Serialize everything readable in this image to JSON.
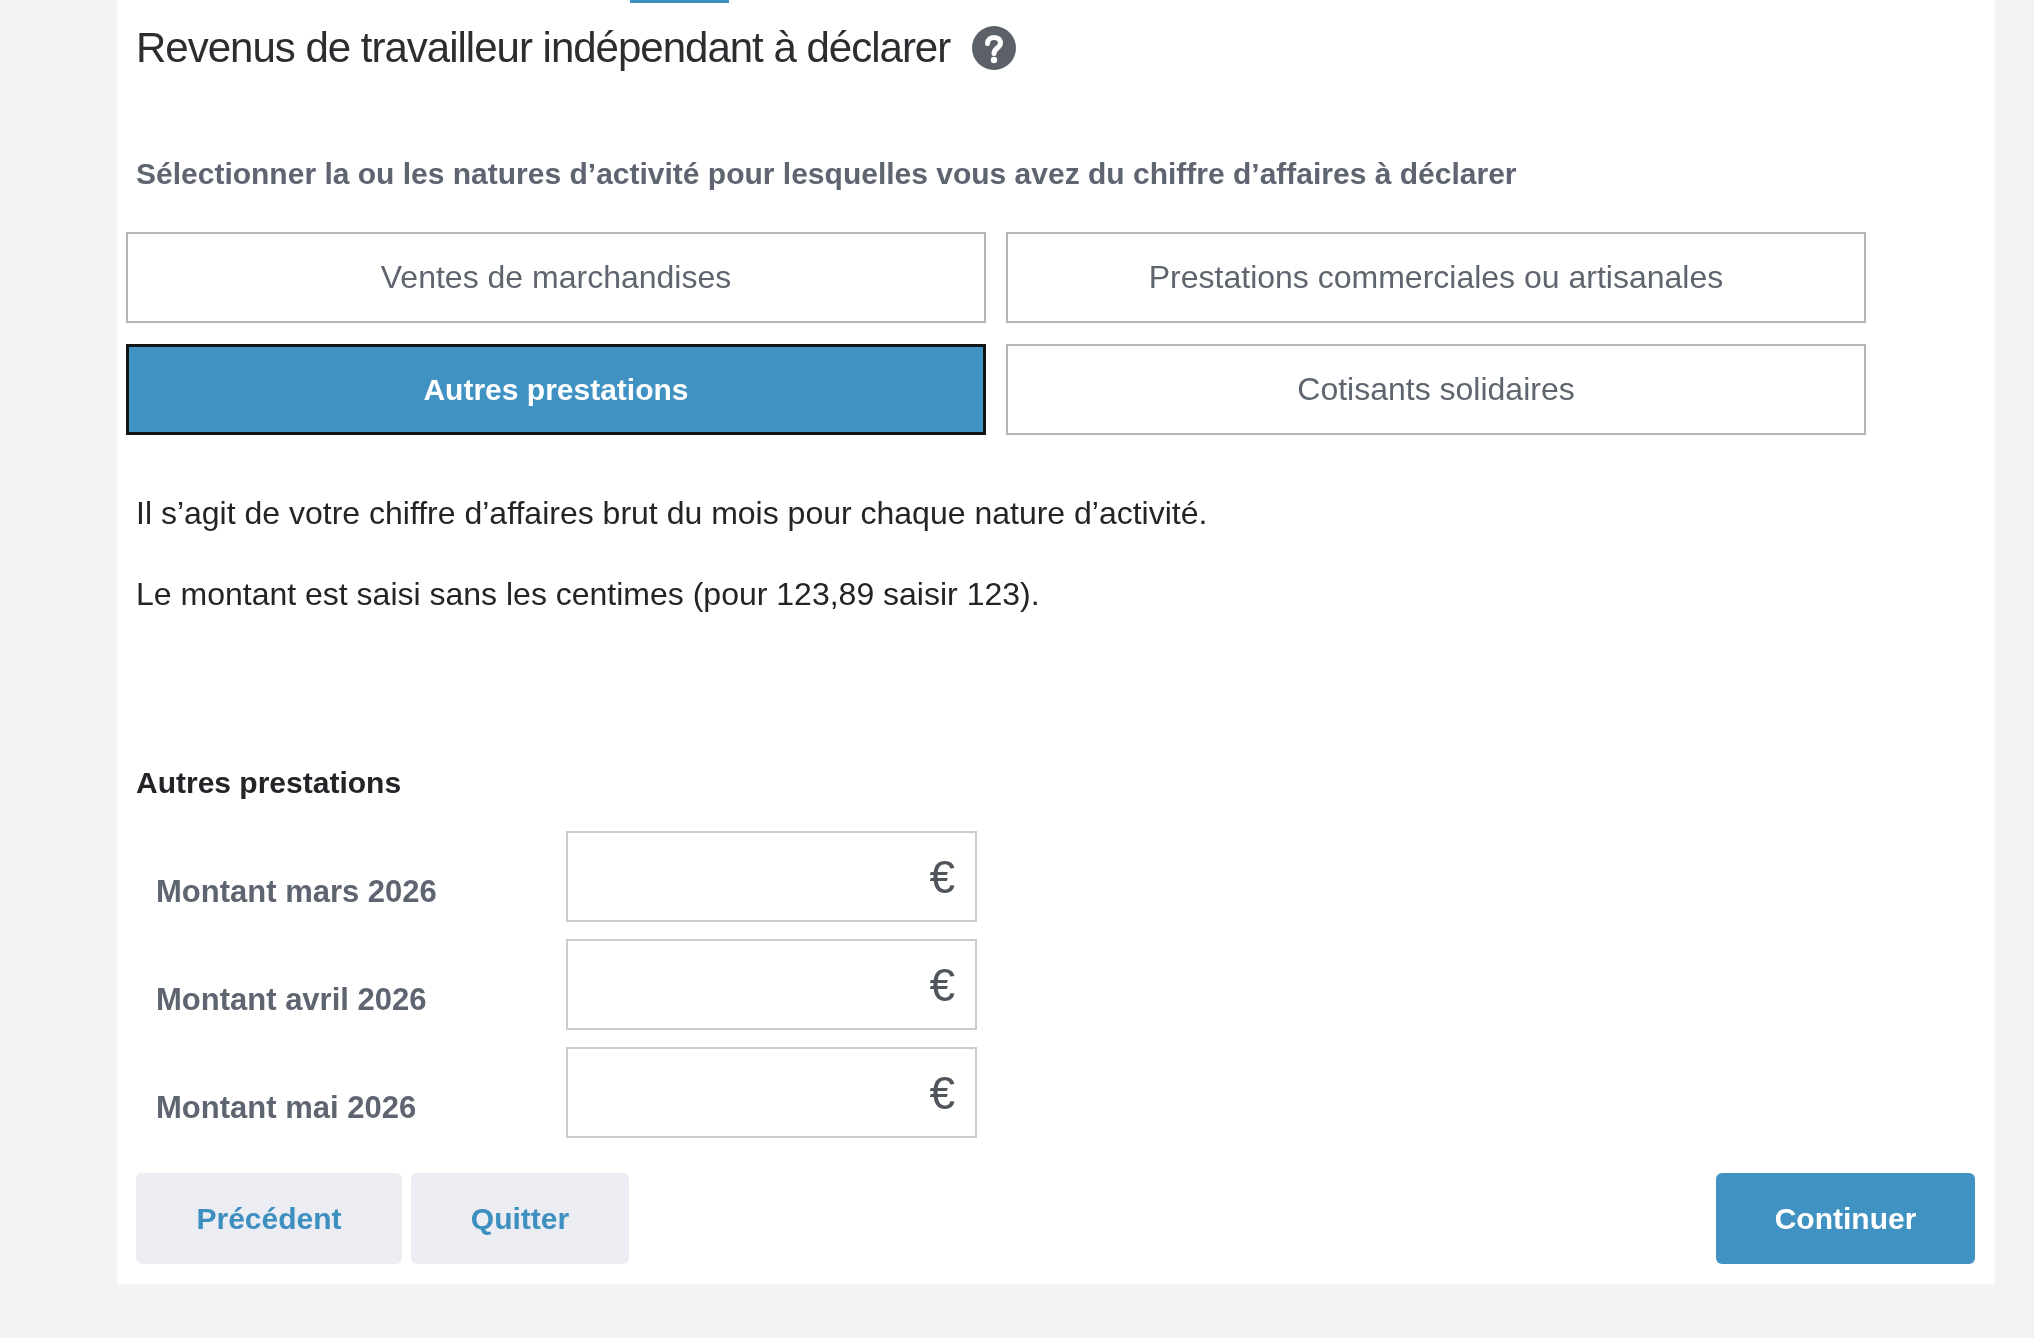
{
  "title": "Revenus de travailleur indépendant à déclarer",
  "intro": "Sélectionner la ou les natures d’activité pour lesquelles vous avez du chiffre d’affaires à déclarer",
  "activity_options": [
    {
      "label": "Ventes de marchandises",
      "selected": false
    },
    {
      "label": "Prestations commerciales ou artisanales",
      "selected": false
    },
    {
      "label": "Autres prestations",
      "selected": true
    },
    {
      "label": "Cotisants solidaires",
      "selected": false
    }
  ],
  "notes": [
    "Il s’agit de votre chiffre d’affaires brut du mois pour chaque nature d’activité.",
    "Le montant est saisi sans les centimes (pour 123,89 saisir 123)."
  ],
  "section": {
    "title": "Autres prestations",
    "fields": [
      {
        "label": "Montant mars 2026",
        "unit": "€"
      },
      {
        "label": "Montant avril 2026",
        "unit": "€"
      },
      {
        "label": "Montant mai 2026",
        "unit": "€"
      }
    ]
  },
  "buttons": [
    {
      "label": "Précédent",
      "kind": "secondary"
    },
    {
      "label": "Quitter",
      "kind": "secondary"
    },
    {
      "label": "Continuer",
      "kind": "primary"
    }
  ]
}
